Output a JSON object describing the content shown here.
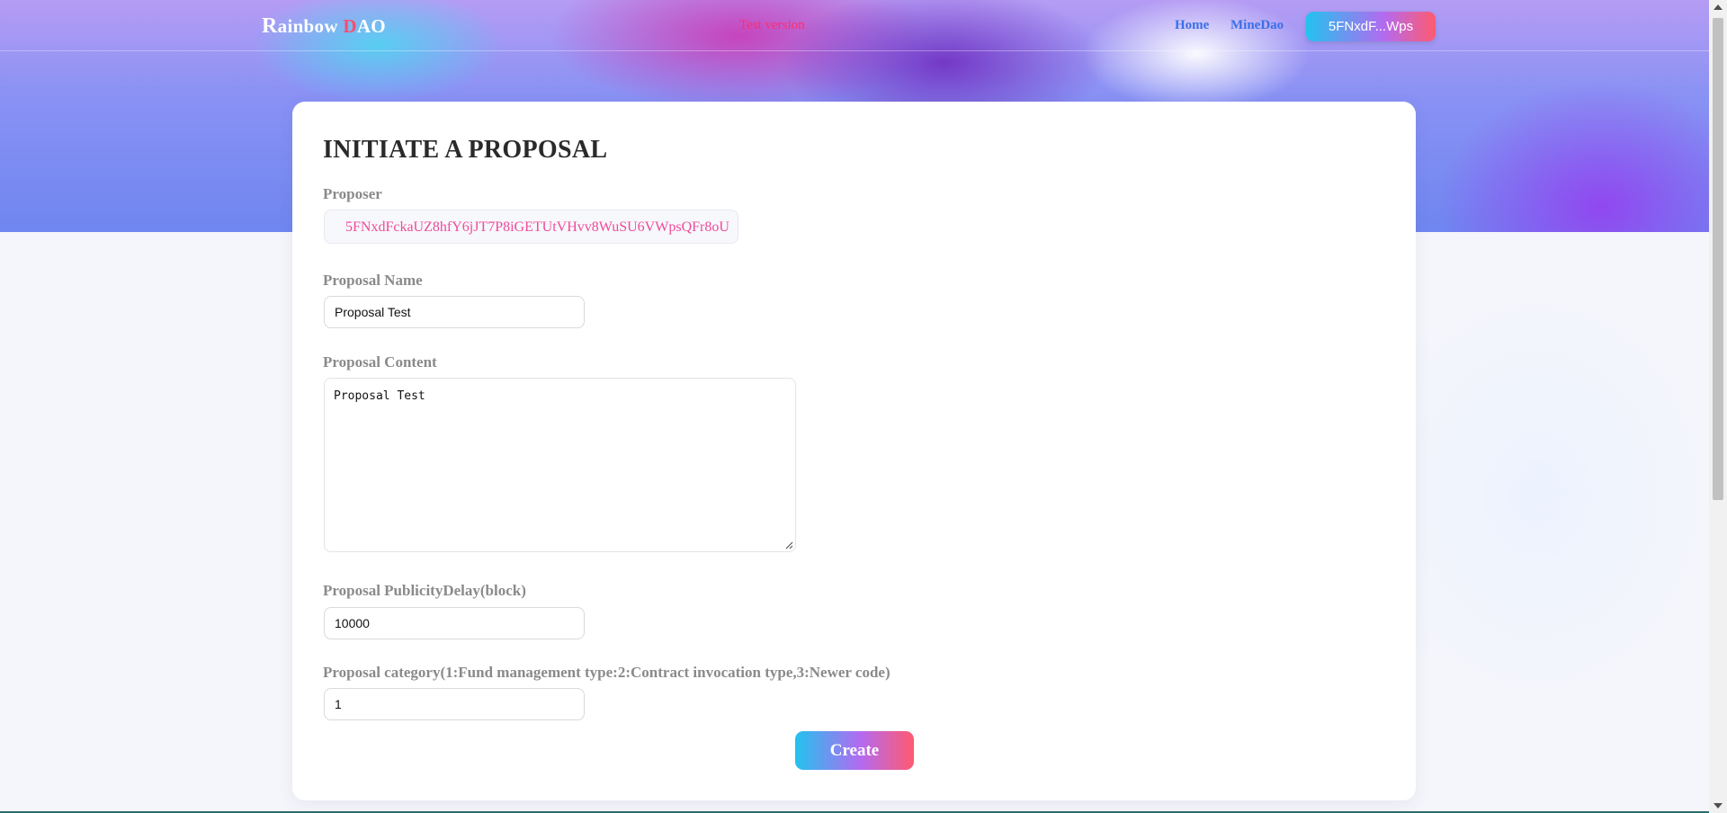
{
  "header": {
    "logo_r": "R",
    "logo_mid": "ainbow ",
    "logo_d": "D",
    "logo_end": "AO",
    "test_label": "Test version",
    "nav": {
      "home": "Home",
      "mine_dao": "MineDao"
    },
    "wallet_button": "5FNxdF...Wps"
  },
  "form": {
    "title": "INITIATE A PROPOSAL",
    "proposer": {
      "label": "Proposer",
      "value": "5FNxdFckaUZ8hfY6jJT7P8iGETUtVHvv8WuSU6VWpsQFr8oU"
    },
    "proposal_name": {
      "label": "Proposal Name",
      "value": "Proposal Test"
    },
    "proposal_content": {
      "label": "Proposal Content",
      "value": "Proposal Test"
    },
    "publicity_delay": {
      "label": "Proposal PublicityDelay(block)",
      "value": "10000"
    },
    "category": {
      "label": "Proposal category(1:Fund management type:2:Contract invocation type,3:Newer code)",
      "value": "1"
    },
    "create_button": "Create"
  },
  "colors": {
    "accent_pink": "#f04a9a",
    "nav_blue": "#3a6fe8",
    "test_red": "#ff2d6f",
    "gradient_start": "#22c3ee",
    "gradient_end": "#ff5a70"
  }
}
